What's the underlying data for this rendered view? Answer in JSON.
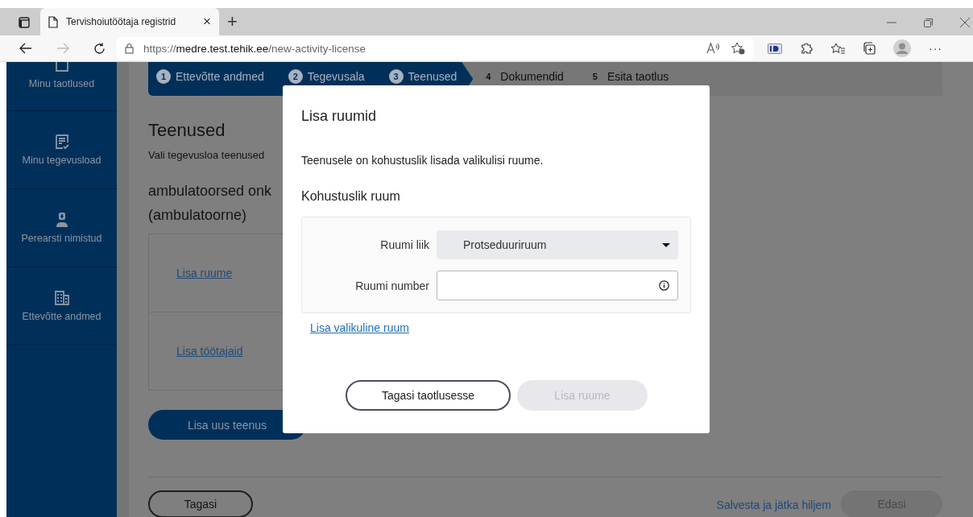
{
  "browser": {
    "tab_title": "Tervishoiutöötaja registrid",
    "tab_close": "×",
    "new_tab": "+",
    "url_prefix": "https://",
    "url_host": "medre.test.tehik.ee",
    "url_path": "/new-activity-license",
    "menu": "···"
  },
  "sidebar": {
    "items": [
      {
        "label": "Minu taotlused"
      },
      {
        "label": "Minu tegevusload"
      },
      {
        "label": "Perearsti nimistud"
      },
      {
        "label": "Ettevõtte andmed"
      }
    ]
  },
  "stepper": [
    {
      "number": "1",
      "label": "Ettevõtte andmed",
      "completed": true,
      "selected": false
    },
    {
      "number": "2",
      "label": "Tegevusala",
      "completed": true,
      "selected": false
    },
    {
      "number": "3",
      "label": "Teenused",
      "completed": false,
      "selected": true
    },
    {
      "number": "4",
      "label": "Dokumendid",
      "completed": false,
      "selected": false
    },
    {
      "number": "5",
      "label": "Esita taotlus",
      "completed": false,
      "selected": false
    }
  ],
  "page": {
    "title": "Teenused",
    "subtitle": "Vali tegevusloa teenused",
    "service_title": "ambulatoorsed onk",
    "service_subtitle": "(ambulatoorne)",
    "service_links": [
      "Lisa ruume",
      "Lisa töötajaid"
    ],
    "add_service_button": "Lisa uus teenus",
    "back_button": "Tagasi",
    "save_link": "Salvesta ja jätka hiljem",
    "next_button": {
      "label": "Edasi",
      "disabled": true
    }
  },
  "modal": {
    "title": "Lisa ruumid",
    "description": "Teenusele on kohustuslik lisada valikulisi ruume.",
    "section_title": "Kohustuslik ruum",
    "fields": [
      {
        "kind": "select",
        "label": "Ruumi liik",
        "value": "Protseduuriruum"
      },
      {
        "kind": "text",
        "label": "Ruumi number"
      }
    ],
    "add_optional_link": "Lisa valikuline ruum",
    "buttons": [
      {
        "label": "Tagasi taotlusesse",
        "kind": "outline",
        "disabled": false
      },
      {
        "label": "Lisa ruume",
        "kind": "primary",
        "disabled": true
      }
    ]
  }
}
